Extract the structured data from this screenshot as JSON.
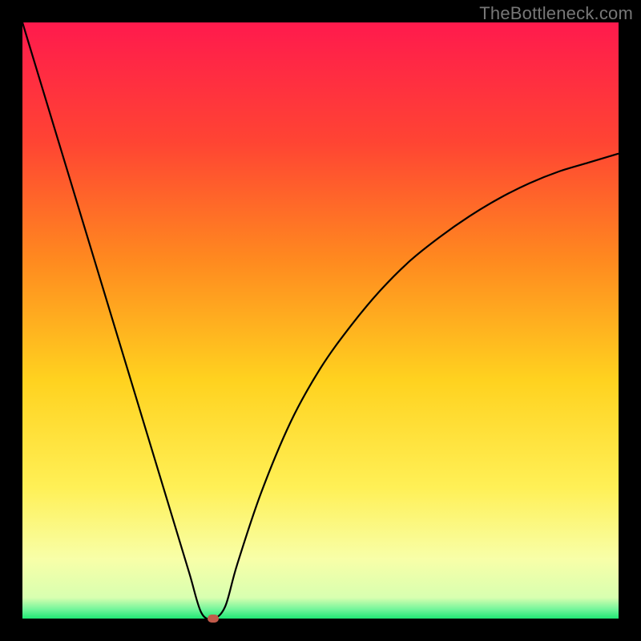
{
  "watermark": "TheBottleneck.com",
  "chart_data": {
    "type": "line",
    "title": "",
    "xlabel": "",
    "ylabel": "",
    "x": [
      0.0,
      0.05,
      0.1,
      0.15,
      0.2,
      0.25,
      0.28,
      0.3,
      0.32,
      0.34,
      0.36,
      0.4,
      0.45,
      0.5,
      0.55,
      0.6,
      0.65,
      0.7,
      0.75,
      0.8,
      0.85,
      0.9,
      0.95,
      1.0
    ],
    "values": [
      1.0,
      0.835,
      0.67,
      0.505,
      0.34,
      0.175,
      0.076,
      0.01,
      0.0,
      0.02,
      0.09,
      0.21,
      0.33,
      0.42,
      0.49,
      0.55,
      0.6,
      0.64,
      0.675,
      0.705,
      0.73,
      0.75,
      0.765,
      0.78
    ],
    "xlim": [
      0,
      1
    ],
    "ylim": [
      0,
      1
    ],
    "marker": {
      "x": 0.32,
      "y": 0.0,
      "color": "#c25a4a"
    },
    "gradient_stops": [
      {
        "pos": 0.0,
        "color": "#ff1a4d"
      },
      {
        "pos": 0.2,
        "color": "#ff4433"
      },
      {
        "pos": 0.4,
        "color": "#ff8a1f"
      },
      {
        "pos": 0.6,
        "color": "#ffd21f"
      },
      {
        "pos": 0.78,
        "color": "#fff056"
      },
      {
        "pos": 0.9,
        "color": "#f8ffa8"
      },
      {
        "pos": 0.965,
        "color": "#d8ffb0"
      },
      {
        "pos": 0.985,
        "color": "#70f59a"
      },
      {
        "pos": 1.0,
        "color": "#1fe874"
      }
    ],
    "line_color": "#000000",
    "line_width": 2.2
  }
}
